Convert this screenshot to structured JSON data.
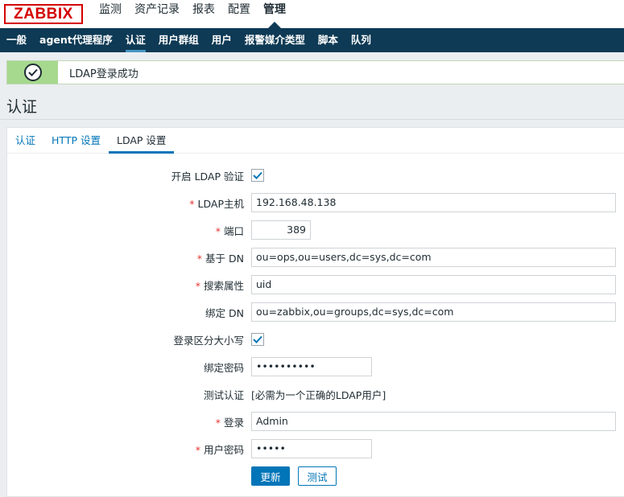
{
  "header": {
    "logo": "ZABBIX",
    "menu": [
      "监测",
      "资产记录",
      "报表",
      "配置",
      "管理"
    ],
    "active_menu": "管理"
  },
  "submenu": {
    "items": [
      "一般",
      "agent代理程序",
      "认证",
      "用户群组",
      "用户",
      "报警媒介类型",
      "脚本",
      "队列"
    ],
    "active": "认证"
  },
  "message": {
    "text": "LDAP登录成功",
    "status": "success"
  },
  "page": {
    "title": "认证"
  },
  "tabs": {
    "items": [
      "认证",
      "HTTP 设置",
      "LDAP 设置"
    ],
    "active": "LDAP 设置"
  },
  "form": {
    "enable_ldap": {
      "label": "开启 LDAP 验证",
      "checked": true
    },
    "ldap_host": {
      "label": "LDAP主机",
      "value": "192.168.48.138",
      "required": true
    },
    "port": {
      "label": "端口",
      "value": "389",
      "required": true
    },
    "base_dn": {
      "label": "基于 DN",
      "value": "ou=ops,ou=users,dc=sys,dc=com",
      "required": true
    },
    "search_attribute": {
      "label": "搜索属性",
      "value": "uid",
      "required": true
    },
    "bind_dn": {
      "label": "绑定 DN",
      "value": "ou=zabbix,ou=groups,dc=sys,dc=com"
    },
    "case_sensitive": {
      "label": "登录区分大小写",
      "checked": true
    },
    "bind_password": {
      "label": "绑定密码",
      "value": "••••••••••"
    },
    "test_auth": {
      "label": "测试认证",
      "note": "[必需为一个正确的LDAP用户]"
    },
    "login": {
      "label": "登录",
      "value": "Admin",
      "required": true
    },
    "user_password": {
      "label": "用户密码",
      "value": "•••••",
      "required": true
    },
    "required_mark": "*"
  },
  "buttons": {
    "update": "更新",
    "test": "测试"
  },
  "colors": {
    "header_dark": "#0e3a55",
    "accent": "#0275b8",
    "success": "#a6d98e",
    "logo_red": "#d40000",
    "required": "#e33734"
  }
}
